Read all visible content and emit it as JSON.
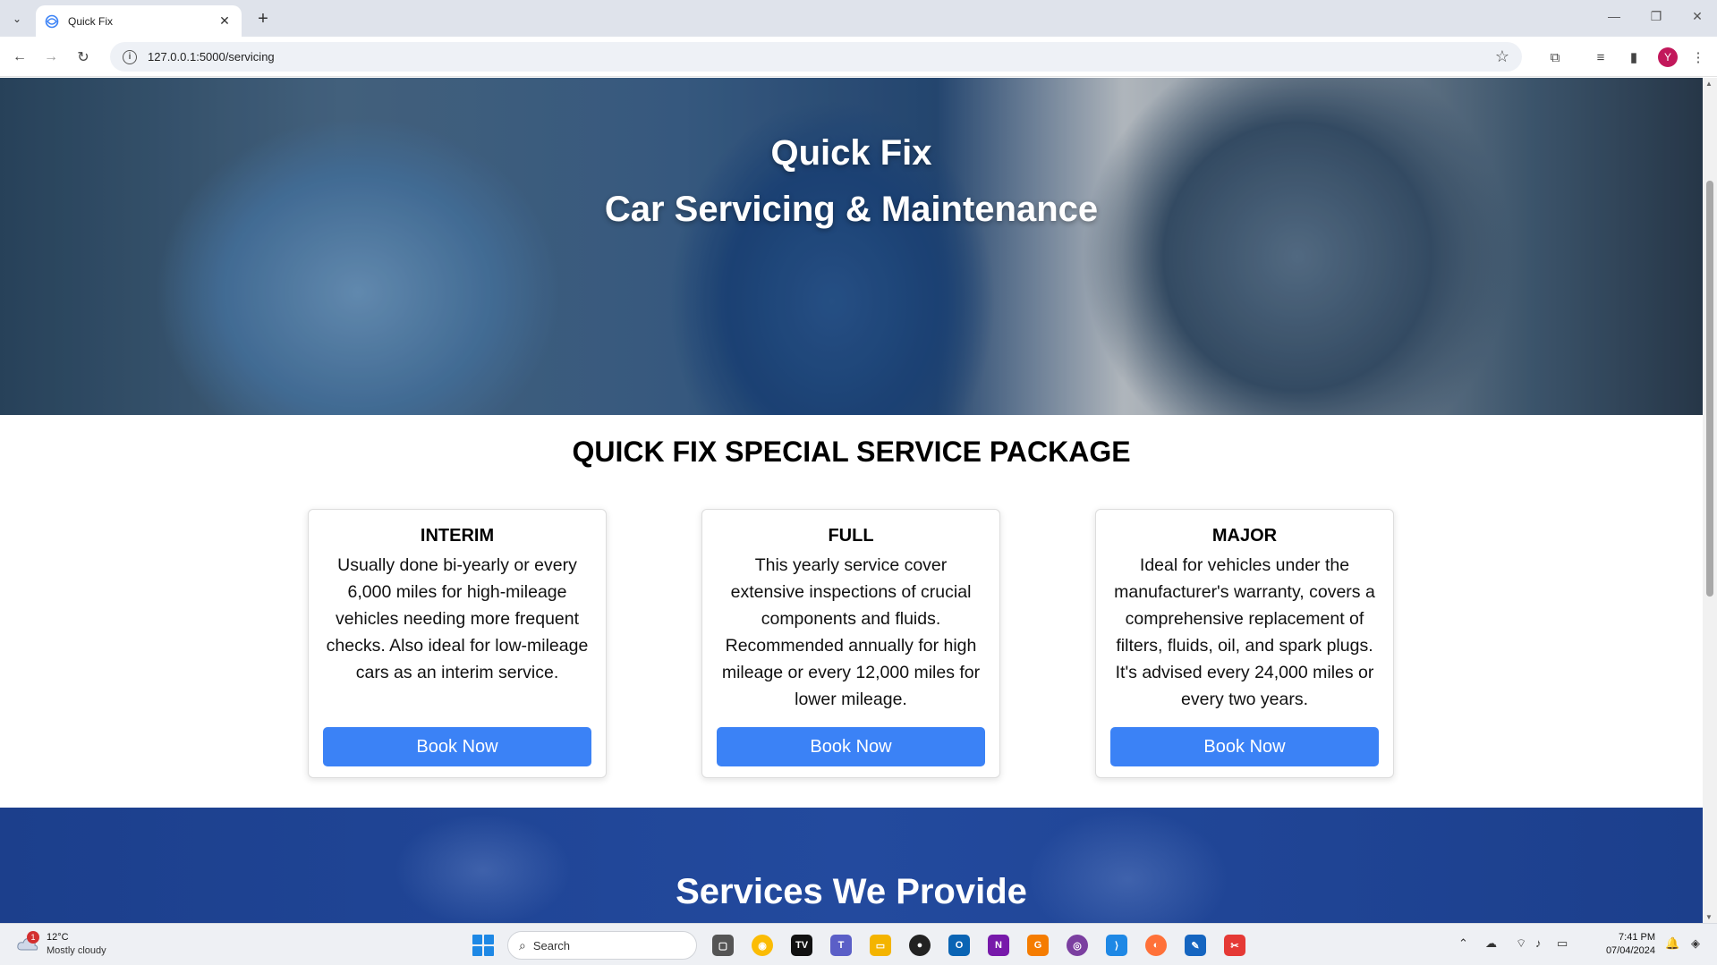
{
  "browser": {
    "tab_title": "Quick Fix",
    "url": "127.0.0.1:5000/servicing",
    "profile_initial": "Y"
  },
  "hero": {
    "title_line1": "Quick Fix",
    "title_line2": "Car Servicing & Maintenance"
  },
  "packages": {
    "heading": "QUICK FIX SPECIAL SERVICE PACKAGE",
    "cards": [
      {
        "title": "INTERIM",
        "description": "Usually done bi-yearly or every 6,000 miles for high-mileage vehicles needing more frequent checks. Also ideal for low-mileage cars as an interim service.",
        "button": "Book Now"
      },
      {
        "title": "FULL",
        "description": "This yearly service cover extensive inspections of crucial components and fluids. Recommended annually for high mileage or every 12,000 miles for lower mileage.",
        "button": "Book Now"
      },
      {
        "title": "MAJOR",
        "description": "Ideal for vehicles under the manufacturer's warranty, covers a comprehensive replacement of filters, fluids, oil, and spark plugs. It's advised every 24,000 miles or every two years.",
        "button": "Book Now"
      }
    ]
  },
  "services": {
    "title": "Services We Provide"
  },
  "taskbar": {
    "weather_temp": "12°C",
    "weather_condition": "Mostly cloudy",
    "weather_badge": "1",
    "search_label": "Search",
    "time": "7:41 PM",
    "date": "07/04/2024"
  },
  "colors": {
    "button_blue": "#3b82f6",
    "services_band": "#234a9e"
  }
}
